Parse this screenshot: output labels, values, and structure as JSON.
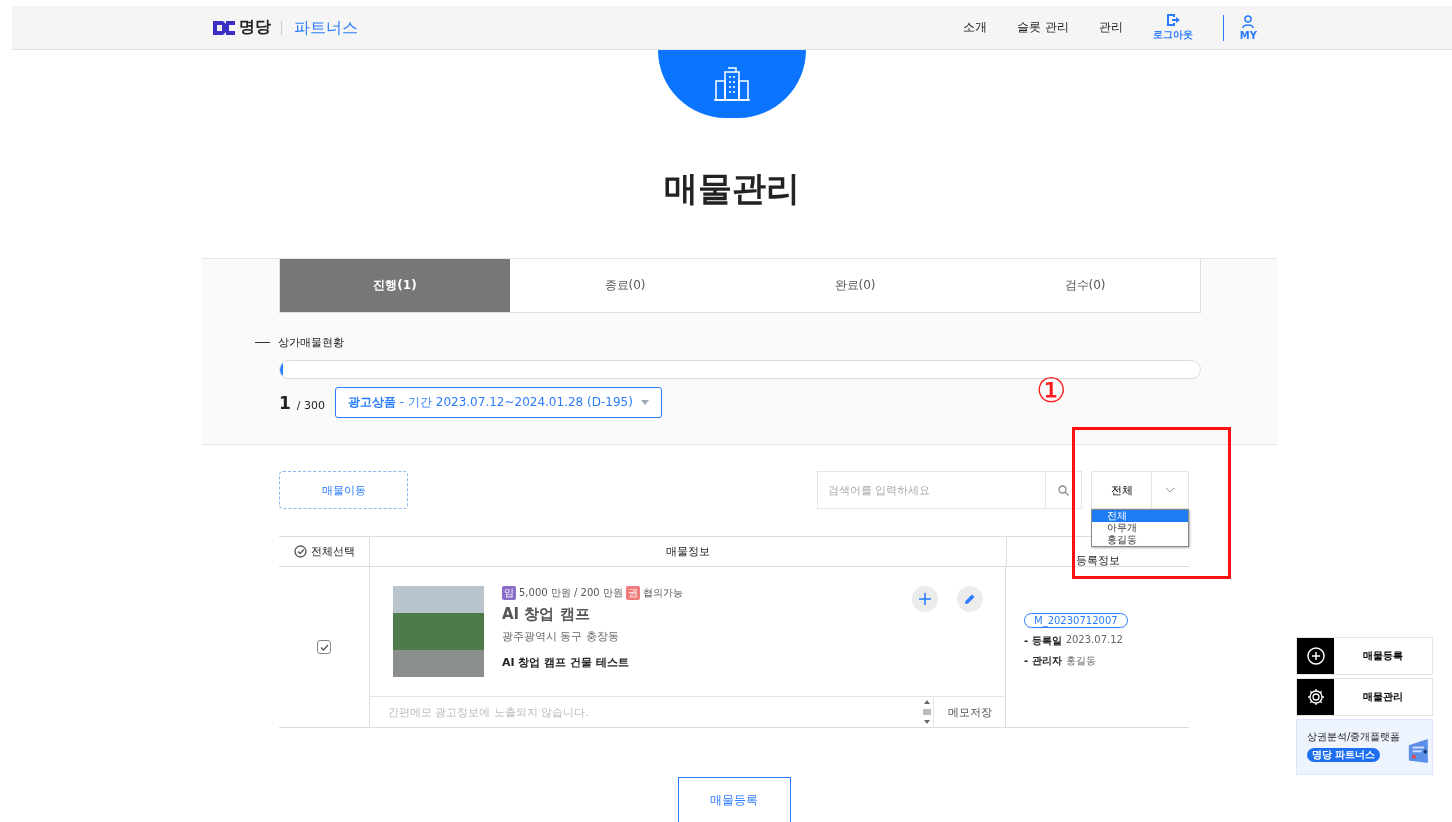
{
  "header": {
    "logo": "명당",
    "brand": "파트너스",
    "nav": [
      "소개",
      "슬롯 관리",
      "관리"
    ],
    "logout": "로그아웃",
    "my": "MY"
  },
  "page_title": "매물관리",
  "tabs": [
    {
      "label": "진행(1)",
      "selected": true
    },
    {
      "label": "종료(0)",
      "selected": false
    },
    {
      "label": "완료(0)",
      "selected": false
    },
    {
      "label": "검수(0)",
      "selected": false
    }
  ],
  "status": {
    "label": "상가매물현황",
    "level": 0.0033,
    "count": "1",
    "total": "/ 300",
    "product": "광고상품",
    "period": " - 기간 2023.07.12~2024.01.28 (D-195)"
  },
  "toolbar": {
    "move_button": "매물이동",
    "search_placeholder": "검색어를 입력하세요",
    "filter_value": "전체",
    "filter_options": [
      {
        "label": "전체",
        "selected": true
      },
      {
        "label": "아무개",
        "selected": false
      },
      {
        "label": "홍길동",
        "selected": false
      }
    ]
  },
  "table": {
    "columns": [
      "전체선택",
      "매물정보",
      "등록정보"
    ],
    "rows": [
      {
        "checked": true,
        "badge_rent": "임",
        "price": "5,000 만원 / 200 만원",
        "badge_premium": "권",
        "negotiable": "협의가능",
        "title": "AI 창업 캠프",
        "address": "광주광역시 동구 충장동",
        "description": "AI 창업 캠프 건물 테스트",
        "memo_placeholder": "간편메모 광고정보에 노출되지 않습니다.",
        "memo_save": "메모저장",
        "code": "M_20230712007",
        "reg_label": "- 등록일",
        "reg_date": "2023.07.12",
        "manager_label": "- 관리자",
        "manager": "홍길동"
      }
    ]
  },
  "register_button": "매물등록",
  "side": {
    "items": [
      {
        "kind": "add",
        "label": "매물등록"
      },
      {
        "kind": "settings",
        "label": "매물관리"
      }
    ],
    "banner_text": "상권분석/중개플랫폼",
    "banner_badge": "명당 파트너스"
  },
  "annotation": {
    "marker": "①"
  }
}
